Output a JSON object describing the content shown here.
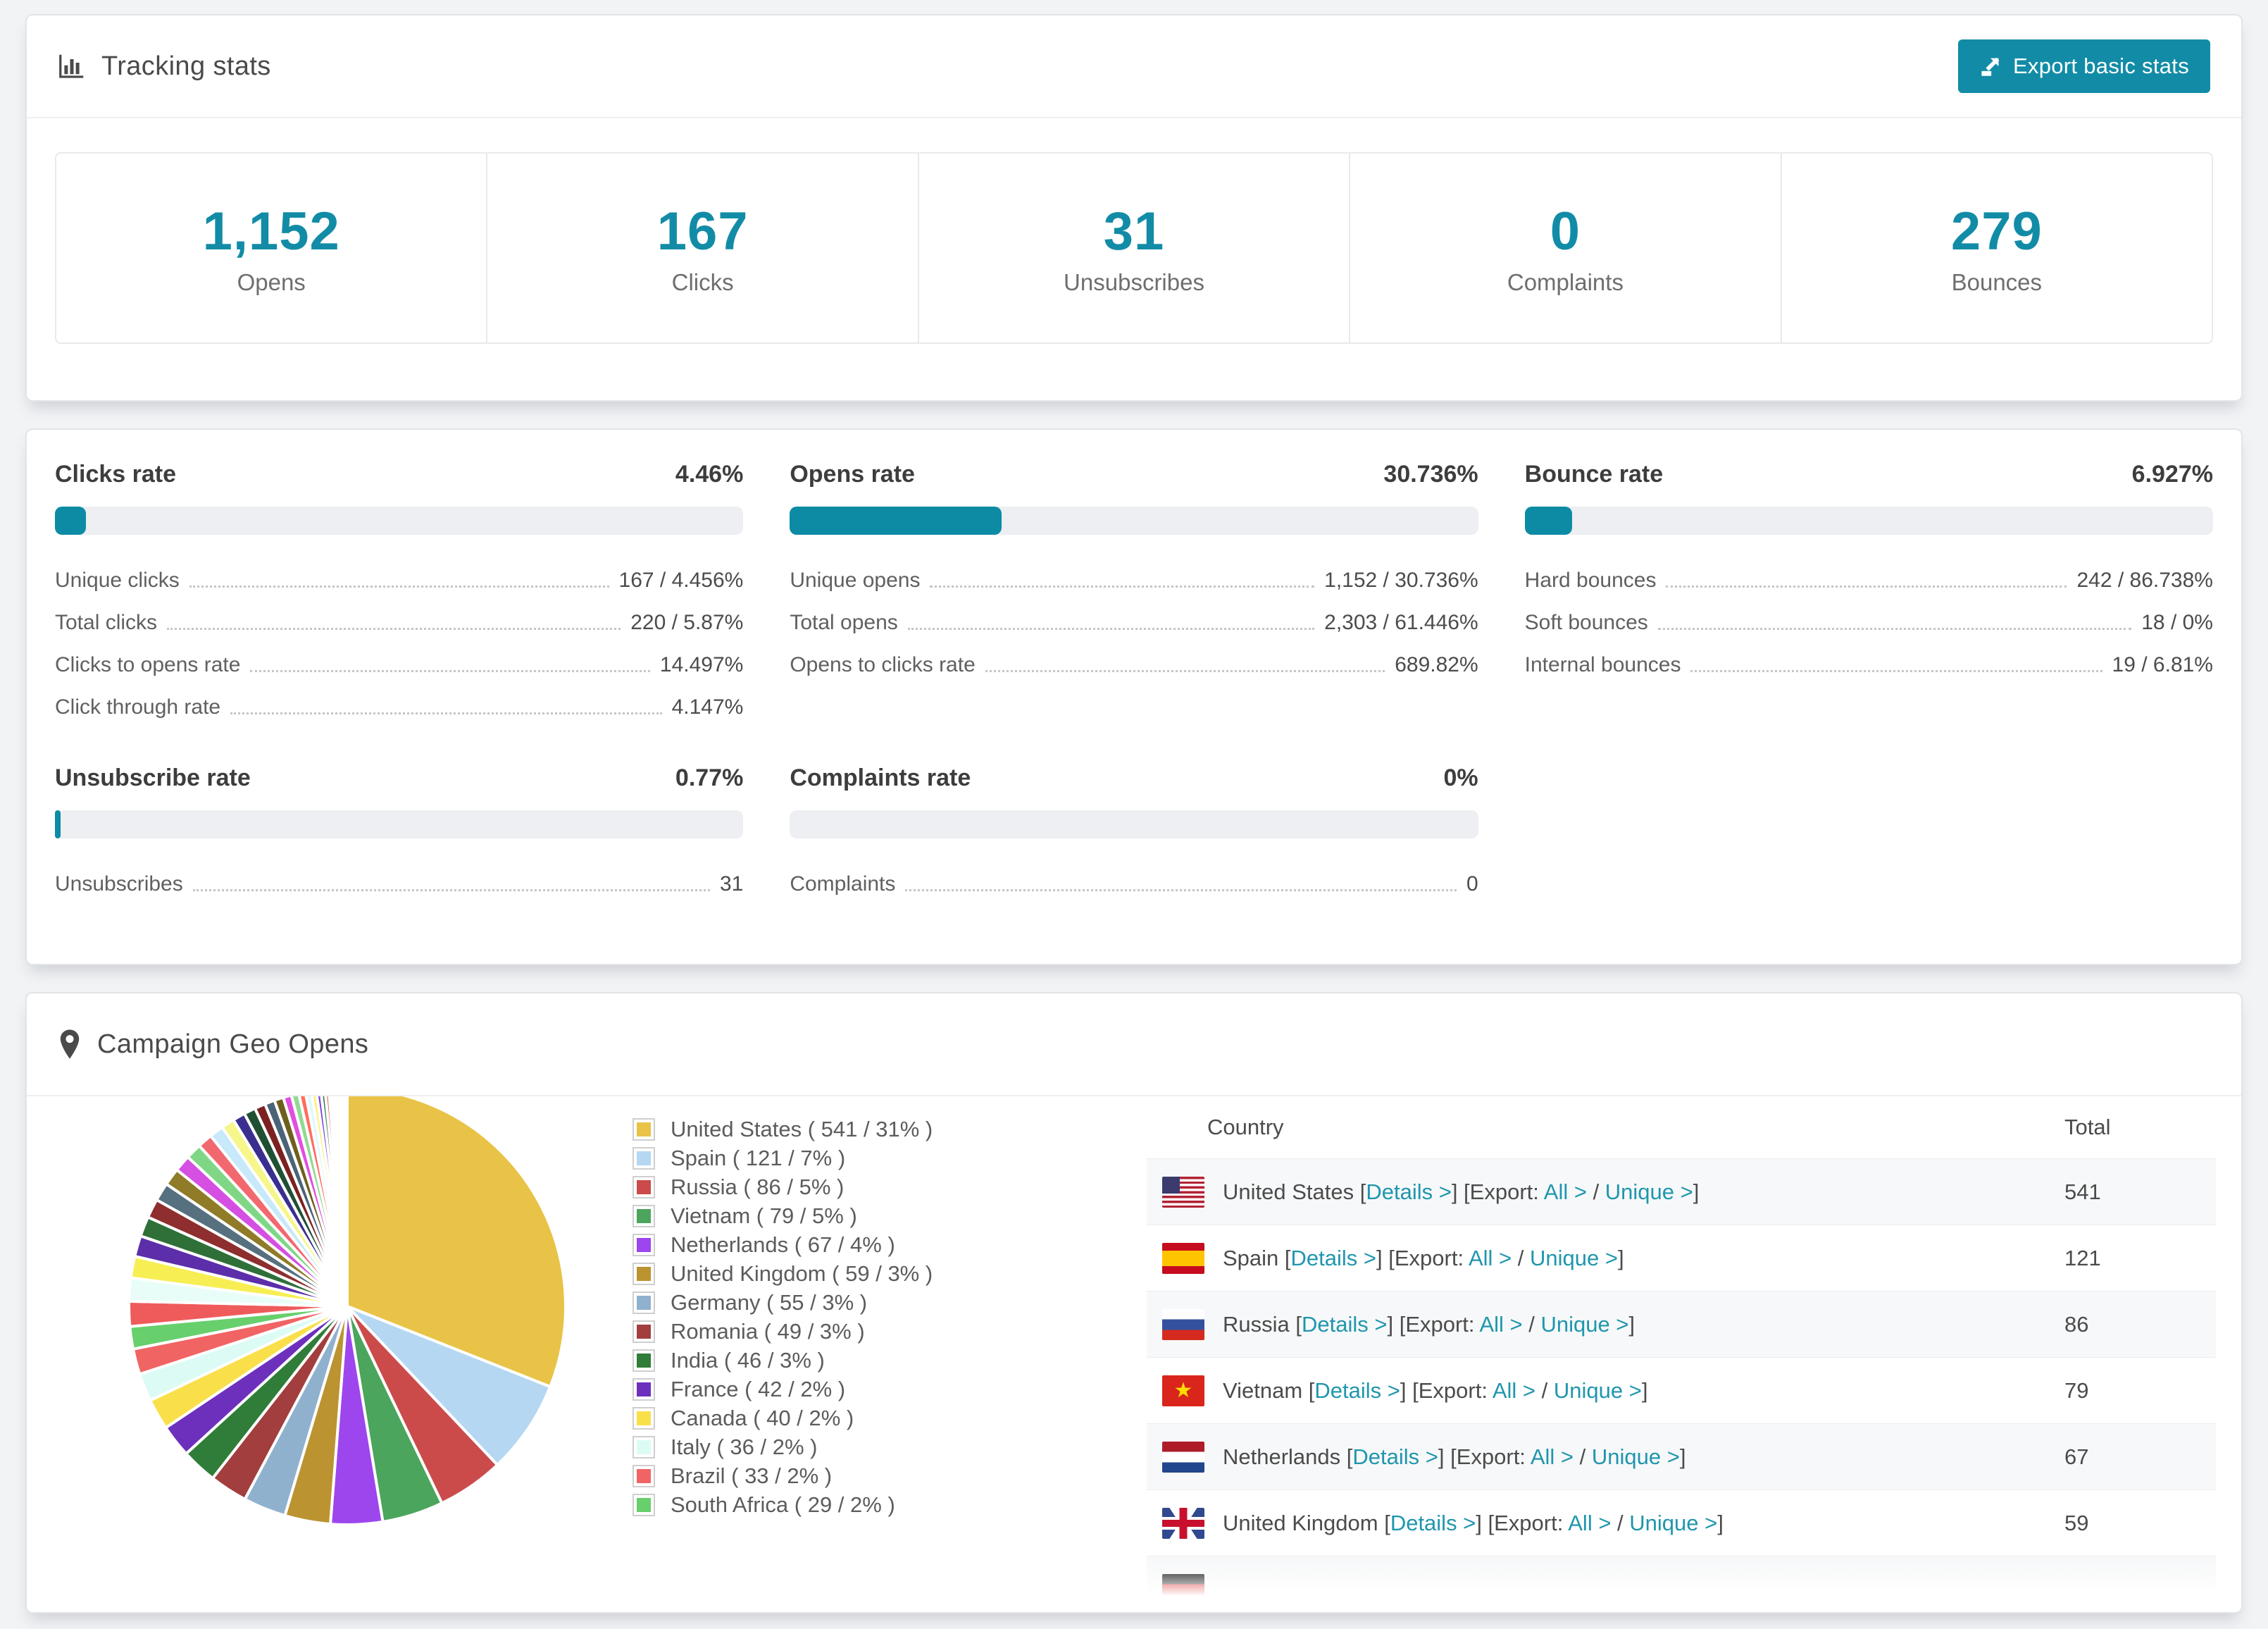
{
  "theme": {
    "accent": "#128ca6",
    "link_color": "#1f96ad",
    "progress_track": "#edeff2",
    "page_background": "#f2f3f5"
  },
  "tracking": {
    "title": "Tracking stats",
    "export_button": "Export basic stats",
    "stats": [
      {
        "value": "1,152",
        "label": "Opens"
      },
      {
        "value": "167",
        "label": "Clicks"
      },
      {
        "value": "31",
        "label": "Unsubscribes"
      },
      {
        "value": "0",
        "label": "Complaints"
      },
      {
        "value": "279",
        "label": "Bounces"
      }
    ]
  },
  "rates": [
    {
      "title": "Clicks rate",
      "value": "4.46%",
      "percent": 4.46,
      "rows": [
        {
          "label": "Unique clicks",
          "value": "167 / 4.456%"
        },
        {
          "label": "Total clicks",
          "value": "220 / 5.87%"
        },
        {
          "label": "Clicks to opens rate",
          "value": "14.497%"
        },
        {
          "label": "Click through rate",
          "value": "4.147%"
        }
      ]
    },
    {
      "title": "Opens rate",
      "value": "30.736%",
      "percent": 30.736,
      "rows": [
        {
          "label": "Unique opens",
          "value": "1,152 / 30.736%"
        },
        {
          "label": "Total opens",
          "value": "2,303 / 61.446%"
        },
        {
          "label": "Opens to clicks rate",
          "value": "689.82%"
        }
      ]
    },
    {
      "title": "Bounce rate",
      "value": "6.927%",
      "percent": 6.927,
      "rows": [
        {
          "label": "Hard bounces",
          "value": "242 / 86.738%"
        },
        {
          "label": "Soft bounces",
          "value": "18 / 0%"
        },
        {
          "label": "Internal bounces",
          "value": "19 / 6.81%"
        }
      ]
    },
    {
      "title": "Unsubscribe rate",
      "value": "0.77%",
      "percent": 0.77,
      "rows": [
        {
          "label": "Unsubscribes",
          "value": "31"
        }
      ]
    },
    {
      "title": "Complaints rate",
      "value": "0%",
      "percent": 0,
      "rows": [
        {
          "label": "Complaints",
          "value": "0"
        }
      ]
    }
  ],
  "geo": {
    "title": "Campaign Geo Opens",
    "table": {
      "headers": {
        "country": "Country",
        "total": "Total"
      },
      "link_labels": {
        "details": "Details >",
        "export_label": "Export:",
        "all": "All >",
        "unique": "Unique >",
        "separator": "/"
      },
      "rows": [
        {
          "flag": "us",
          "country": "United States",
          "total": "541"
        },
        {
          "flag": "es",
          "country": "Spain",
          "total": "121"
        },
        {
          "flag": "ru",
          "country": "Russia",
          "total": "86"
        },
        {
          "flag": "vn",
          "country": "Vietnam",
          "total": "79"
        },
        {
          "flag": "nl",
          "country": "Netherlands",
          "total": "67"
        },
        {
          "flag": "gb",
          "country": "United Kingdom",
          "total": "59"
        },
        {
          "flag": "de",
          "country": "",
          "total": ""
        }
      ]
    }
  },
  "chart_data": {
    "type": "pie",
    "title": "Campaign Geo Opens",
    "unit": "opens",
    "start_angle": "top",
    "direction": "clockwise",
    "legend_position": "right of pie",
    "labels": [
      "United States",
      "Spain",
      "Russia",
      "Vietnam",
      "Netherlands",
      "United Kingdom",
      "Germany",
      "Romania",
      "India",
      "France",
      "Canada",
      "Italy",
      "Brazil",
      "South Africa"
    ],
    "values": [
      541,
      121,
      86,
      79,
      67,
      59,
      55,
      49,
      46,
      42,
      40,
      36,
      33,
      29
    ],
    "percents": [
      31,
      7,
      5,
      5,
      4,
      3,
      3,
      3,
      3,
      2,
      2,
      2,
      2,
      2
    ],
    "colors": [
      "#e8c347",
      "#b5d7f2",
      "#cb4b4b",
      "#4ba55c",
      "#9d46ee",
      "#bb9330",
      "#90b1cd",
      "#a23e3e",
      "#2f7d38",
      "#6c30bd",
      "#f9e04b",
      "#dcfbf5",
      "#f16464",
      "#68cf6d"
    ],
    "legend_labels": [
      "United States ( 541 / 31% )",
      "Spain ( 121 / 7% )",
      "Russia ( 86 / 5% )",
      "Vietnam ( 79 / 5% )",
      "Netherlands ( 67 / 4% )",
      "United Kingdom ( 59 / 3% )",
      "Germany ( 55 / 3% )",
      "Romania ( 49 / 3% )",
      "India ( 46 / 3% )",
      "France ( 42 / 2% )",
      "Canada ( 40 / 2% )",
      "Italy ( 36 / 2% )",
      "Brazil ( 33 / 2% )",
      "South Africa ( 29 / 2% )"
    ],
    "other_slices": {
      "note": "many small unlabeled country slices, sizes estimated from pie",
      "estimated_total": 462,
      "weights": [
        30,
        28,
        26,
        25,
        24,
        23,
        22,
        21,
        20,
        19,
        18,
        17,
        16,
        15,
        14,
        13,
        12,
        11,
        10,
        9,
        8,
        7,
        6,
        5.5,
        5,
        4.5,
        4,
        3.5,
        3,
        2.6,
        2.2,
        1.9,
        1.6,
        1.3,
        1.1,
        0.9
      ],
      "palette": [
        "#ef5b5b",
        "#e8fdf8",
        "#f7ee54",
        "#5c2ea9",
        "#2e7038",
        "#8e2e2e",
        "#57707f",
        "#8f7b28",
        "#d44fe2",
        "#7fd786",
        "#f2686f",
        "#c7e9f9",
        "#f6f68a",
        "#3a2f8f",
        "#205033",
        "#7c2121",
        "#4a6377",
        "#6f5f1f",
        "#e14fe1",
        "#90da93",
        "#ff6d60",
        "#dff7ff",
        "#fff176",
        "#7b3fe4",
        "#33804d"
      ]
    }
  }
}
